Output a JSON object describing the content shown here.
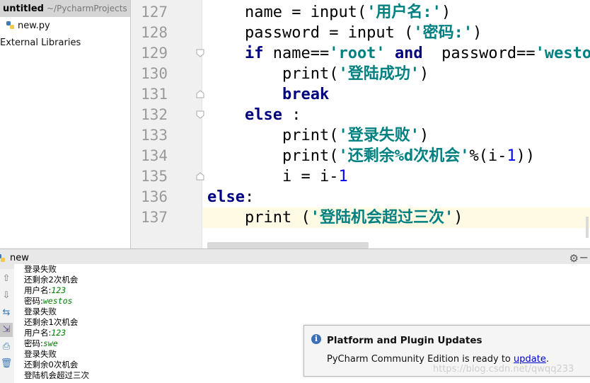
{
  "project": {
    "root_name": "untitled",
    "root_path": "~/PycharmProjects",
    "file": "new.py",
    "external_libraries": "External Libraries"
  },
  "editor": {
    "lines": [
      {
        "num": "127",
        "indent": "    ",
        "tokens": [
          {
            "t": "name = ",
            "c": "plain"
          },
          {
            "t": "input",
            "c": "plain"
          },
          {
            "t": "(",
            "c": "plain"
          },
          {
            "t": "'用户名:'",
            "c": "str"
          },
          {
            "t": ")",
            "c": "plain"
          }
        ]
      },
      {
        "num": "128",
        "indent": "    ",
        "tokens": [
          {
            "t": "password = ",
            "c": "plain"
          },
          {
            "t": "input",
            "c": "plain"
          },
          {
            "t": " (",
            "c": "plain"
          },
          {
            "t": "'密码:'",
            "c": "str"
          },
          {
            "t": ")",
            "c": "plain"
          }
        ]
      },
      {
        "num": "129",
        "indent": "    ",
        "tokens": [
          {
            "t": "if",
            "c": "kw"
          },
          {
            "t": " name==",
            "c": "plain"
          },
          {
            "t": "'root'",
            "c": "str"
          },
          {
            "t": " ",
            "c": "plain"
          },
          {
            "t": "and",
            "c": "kw"
          },
          {
            "t": "  password==",
            "c": "plain"
          },
          {
            "t": "'westos'",
            "c": "str"
          },
          {
            "t": ":",
            "c": "plain"
          }
        ]
      },
      {
        "num": "130",
        "indent": "        ",
        "tokens": [
          {
            "t": "print",
            "c": "plain"
          },
          {
            "t": "(",
            "c": "plain"
          },
          {
            "t": "'登陆成功'",
            "c": "str"
          },
          {
            "t": ")",
            "c": "plain"
          }
        ]
      },
      {
        "num": "131",
        "indent": "        ",
        "tokens": [
          {
            "t": "break",
            "c": "kw"
          }
        ]
      },
      {
        "num": "132",
        "indent": "    ",
        "tokens": [
          {
            "t": "else",
            "c": "kw"
          },
          {
            "t": " :",
            "c": "plain"
          }
        ]
      },
      {
        "num": "133",
        "indent": "        ",
        "tokens": [
          {
            "t": "print",
            "c": "plain"
          },
          {
            "t": "(",
            "c": "plain"
          },
          {
            "t": "'登录失败'",
            "c": "str"
          },
          {
            "t": ")",
            "c": "plain"
          }
        ]
      },
      {
        "num": "134",
        "indent": "        ",
        "tokens": [
          {
            "t": "print",
            "c": "plain"
          },
          {
            "t": "(",
            "c": "plain"
          },
          {
            "t": "'还剩余%d次机会'",
            "c": "str"
          },
          {
            "t": "%(i-",
            "c": "plain"
          },
          {
            "t": "1",
            "c": "num"
          },
          {
            "t": "))",
            "c": "plain"
          }
        ]
      },
      {
        "num": "135",
        "indent": "        ",
        "tokens": [
          {
            "t": "i = i-",
            "c": "plain"
          },
          {
            "t": "1",
            "c": "num"
          }
        ]
      },
      {
        "num": "136",
        "indent": "",
        "tokens": [
          {
            "t": "else",
            "c": "kw"
          },
          {
            "t": ":",
            "c": "plain"
          }
        ]
      },
      {
        "num": "137",
        "indent": "    ",
        "tokens": [
          {
            "t": "print",
            "c": "plain"
          },
          {
            "t": " (",
            "c": "plain"
          },
          {
            "t": "'登陆机会超过三次'",
            "c": "str"
          },
          {
            "t": ")",
            "c": "plain"
          }
        ]
      }
    ]
  },
  "run": {
    "title": "new",
    "output": [
      {
        "label": "登录失败",
        "input": ""
      },
      {
        "label": "还剩余2次机会",
        "input": ""
      },
      {
        "label": "用户名:",
        "input": "123"
      },
      {
        "label": "密码:",
        "input": "westos"
      },
      {
        "label": "登录失败",
        "input": ""
      },
      {
        "label": "还剩余1次机会",
        "input": ""
      },
      {
        "label": "用户名:",
        "input": "123"
      },
      {
        "label": "密码:",
        "input": "swe"
      },
      {
        "label": "登录失败",
        "input": ""
      },
      {
        "label": "还剩余0次机会",
        "input": ""
      },
      {
        "label": "登陆机会超过三次",
        "input": ""
      }
    ]
  },
  "notification": {
    "title": "Platform and Plugin Updates",
    "text": "PyCharm Community Edition is ready to ",
    "link": "update",
    "suffix": "."
  },
  "watermark": "https://blog.csdn.net/qwqq233"
}
